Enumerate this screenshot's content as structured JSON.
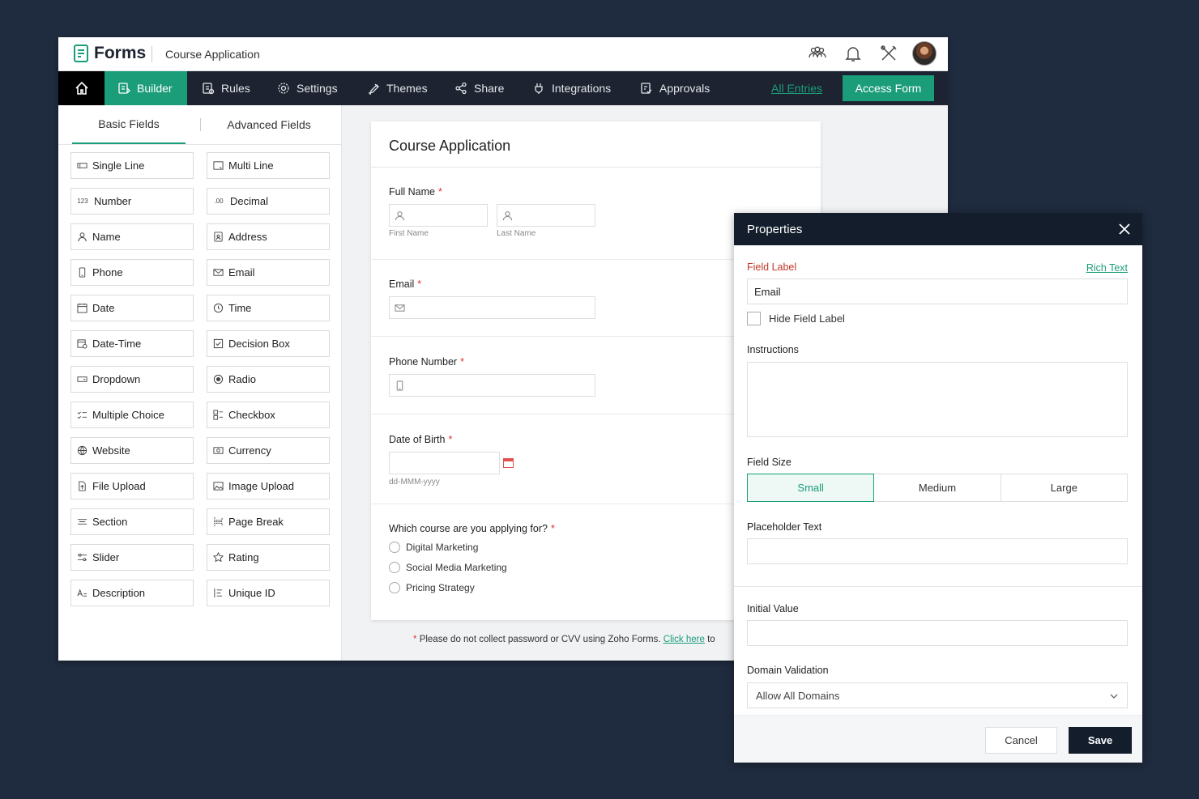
{
  "app": {
    "logo_text": "Forms",
    "form_title": "Course Application"
  },
  "top_icons": [
    "users-icon",
    "bell-icon",
    "tools-icon",
    "avatar"
  ],
  "nav": {
    "items": [
      {
        "label": "Builder",
        "icon": "builder-icon",
        "active": true
      },
      {
        "label": "Rules",
        "icon": "rules-icon"
      },
      {
        "label": "Settings",
        "icon": "gear-icon"
      },
      {
        "label": "Themes",
        "icon": "brush-icon"
      },
      {
        "label": "Share",
        "icon": "share-icon"
      },
      {
        "label": "Integrations",
        "icon": "plug-icon"
      },
      {
        "label": "Approvals",
        "icon": "approval-icon"
      }
    ],
    "all_entries": "All Entries",
    "access_form": "Access Form"
  },
  "left_panel": {
    "tabs": [
      "Basic Fields",
      "Advanced Fields"
    ],
    "fields": [
      [
        "Single Line",
        "Multi Line"
      ],
      [
        "Number",
        "Decimal"
      ],
      [
        "Name",
        "Address"
      ],
      [
        "Phone",
        "Email"
      ],
      [
        "Date",
        "Time"
      ],
      [
        "Date-Time",
        "Decision Box"
      ],
      [
        "Dropdown",
        "Radio"
      ],
      [
        "Multiple Choice",
        "Checkbox"
      ],
      [
        "Website",
        "Currency"
      ],
      [
        "File Upload",
        "Image Upload"
      ],
      [
        "Section",
        "Page Break"
      ],
      [
        "Slider",
        "Rating"
      ],
      [
        "Description",
        "Unique ID"
      ]
    ],
    "number_glyph": "123",
    "decimal_glyph": ".00"
  },
  "form": {
    "title": "Course Application",
    "full_name_label": "Full Name",
    "first_name": "First Name",
    "last_name": "Last Name",
    "email_label": "Email",
    "phone_label": "Phone Number",
    "dob_label": "Date of Birth",
    "dob_format": "dd-MMM-yyyy",
    "course_label": "Which course are you applying for?",
    "course_options": [
      "Digital Marketing",
      "Social Media Marketing",
      "Pricing Strategy"
    ],
    "required_mark": "*",
    "notice_text": "Please do not collect password or CVV using Zoho Forms.",
    "notice_link": "Click here",
    "notice_tail": "to"
  },
  "properties": {
    "title": "Properties",
    "field_label_title": "Field Label",
    "rich_text": "Rich Text",
    "field_label_value": "Email",
    "hide_label": "Hide Field Label",
    "instructions": "Instructions",
    "field_size": "Field Size",
    "size_options": [
      "Small",
      "Medium",
      "Large"
    ],
    "size_selected": "Small",
    "placeholder_text": "Placeholder Text",
    "initial_value": "Initial Value",
    "domain_validation": "Domain Validation",
    "domain_selected": "Allow All Domains",
    "cancel": "Cancel",
    "save": "Save"
  },
  "colors": {
    "accent": "#1b9d7a",
    "navbar": "#1d2330",
    "panel_header": "#131d2c",
    "required": "#e03131",
    "background": "#1f2b3e"
  }
}
